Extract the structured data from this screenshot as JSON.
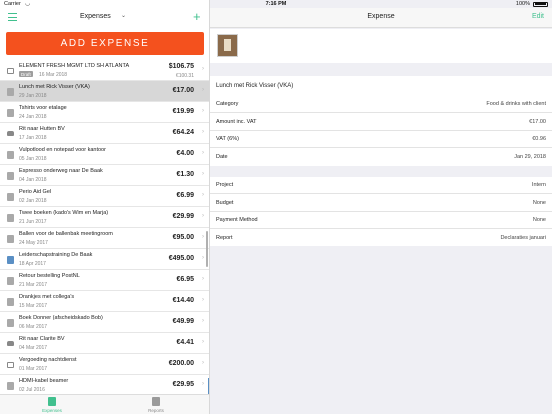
{
  "status_bar": {
    "carrier": "Carrier",
    "time": "7:16 PM",
    "battery": "100%"
  },
  "left_nav": {
    "title": "Expenses"
  },
  "add_button": {
    "label": "ADD EXPENSE"
  },
  "expenses": [
    {
      "title": "ELEMENT FRESH MGMT LTD SH ATLANTA",
      "badge": "Draft",
      "date": "16 Mar 2018",
      "amount": "$106.75",
      "amount_secondary": "€100.31",
      "icon": "card-icon",
      "selected": false
    },
    {
      "title": "Lunch met Rick Visser (VKA)",
      "date": "29 Jan 2018",
      "amount": "€17.00",
      "icon": "receipt-icon",
      "selected": true
    },
    {
      "title": "Tshirts voor etalage",
      "date": "24 Jan 2018",
      "amount": "€19.99",
      "icon": "receipt-icon",
      "selected": false
    },
    {
      "title": "Rit naar Hutten BV",
      "date": "17 Jan 2018",
      "amount": "€64.24",
      "icon": "car-icon",
      "selected": false
    },
    {
      "title": "Vulpotlood en notepad voor kantoor",
      "date": "05 Jan 2018",
      "amount": "€4.00",
      "icon": "receipt-icon",
      "selected": false
    },
    {
      "title": "Espresso onderweg naar De Baak",
      "date": "04 Jan 2018",
      "amount": "€1.30",
      "icon": "receipt-icon",
      "selected": false
    },
    {
      "title": "Perio Aid Gel",
      "date": "02 Jan 2018",
      "amount": "€6.99",
      "icon": "receipt-icon",
      "selected": false
    },
    {
      "title": "Twee boeken (kado's Wim en Marja)",
      "date": "21 Jun 2017",
      "amount": "€29.99",
      "icon": "receipt-icon",
      "selected": false
    },
    {
      "title": "Ballen voor de ballenbak meetingroom",
      "date": "24 May 2017",
      "amount": "€95.00",
      "icon": "receipt-icon",
      "selected": false
    },
    {
      "title": "Leiderschapstraining De Baak",
      "date": "18 Apr 2017",
      "amount": "€495.00",
      "icon": "photo-icon",
      "selected": false
    },
    {
      "title": "Retour bestelling PostNL",
      "date": "21 Mar 2017",
      "amount": "€6.95",
      "icon": "receipt-icon",
      "selected": false
    },
    {
      "title": "Drankjes met collega's",
      "date": "15 Mar 2017",
      "amount": "€14.40",
      "icon": "receipt-icon",
      "selected": false
    },
    {
      "title": "Boek Donner (afscheidskado Bob)",
      "date": "06 Mar 2017",
      "amount": "€49.99",
      "icon": "receipt-icon",
      "selected": false
    },
    {
      "title": "Rit naar Clarite BV",
      "date": "04 Mar 2017",
      "amount": "€4.41",
      "icon": "car-icon",
      "selected": false
    },
    {
      "title": "Vergoeding nachtdienst",
      "date": "01 Mar 2017",
      "amount": "€200.00",
      "icon": "card-icon",
      "selected": false
    },
    {
      "title": "HDMI-kabel beamer",
      "date": "02 Jul 2016",
      "amount": "€29.95",
      "icon": "receipt-icon",
      "selected": false
    }
  ],
  "tabs": [
    {
      "label": "Expenses",
      "active": true
    },
    {
      "label": "Reports",
      "active": false
    }
  ],
  "detail": {
    "nav_title": "Expense",
    "edit_label": "Edit",
    "description": "Lunch met Rick Visser (VKA)",
    "fields_1": [
      {
        "label": "Category",
        "value": "Food & drinks with client"
      },
      {
        "label": "Amount inc. VAT",
        "value": "€17.00"
      },
      {
        "label": "VAT (6%)",
        "value": "€0.96"
      },
      {
        "label": "Date",
        "value": "Jan 29, 2018"
      }
    ],
    "fields_2": [
      {
        "label": "Project",
        "value": "Intern"
      },
      {
        "label": "Budget",
        "value": "None"
      },
      {
        "label": "Payment Method",
        "value": "None"
      },
      {
        "label": "Report",
        "value": "Declaraties januari"
      }
    ]
  },
  "colors": {
    "accent": "#41c08e",
    "button": "#f4511e"
  }
}
